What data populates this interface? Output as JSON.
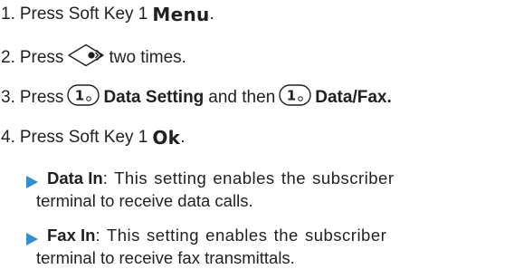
{
  "steps": [
    {
      "number": "1.",
      "text": "Press Soft Key 1",
      "key": "Menu",
      "end": "."
    },
    {
      "number": "2.",
      "text_before": "Press",
      "text_after": "two times."
    },
    {
      "number": "3.",
      "press": "Press",
      "label1": "Data Setting",
      "and_then": "and then",
      "label2": "Data/Fax."
    },
    {
      "number": "4.",
      "text": "Press Soft Key 1",
      "key": "Ok",
      "end": "."
    }
  ],
  "bullets": [
    {
      "title": "Data In",
      "line1": ": This setting enables the subscriber",
      "line2": "terminal to receive data calls."
    },
    {
      "title": "Fax In",
      "line1": ": This setting enables the subscriber",
      "line2": "terminal to receive fax transmittals."
    }
  ],
  "icons": {
    "nav": "nav-key-right-icon",
    "key1": "key-1-icon"
  },
  "colors": {
    "text": "#231f20",
    "bullet": "#2d8fd5"
  }
}
